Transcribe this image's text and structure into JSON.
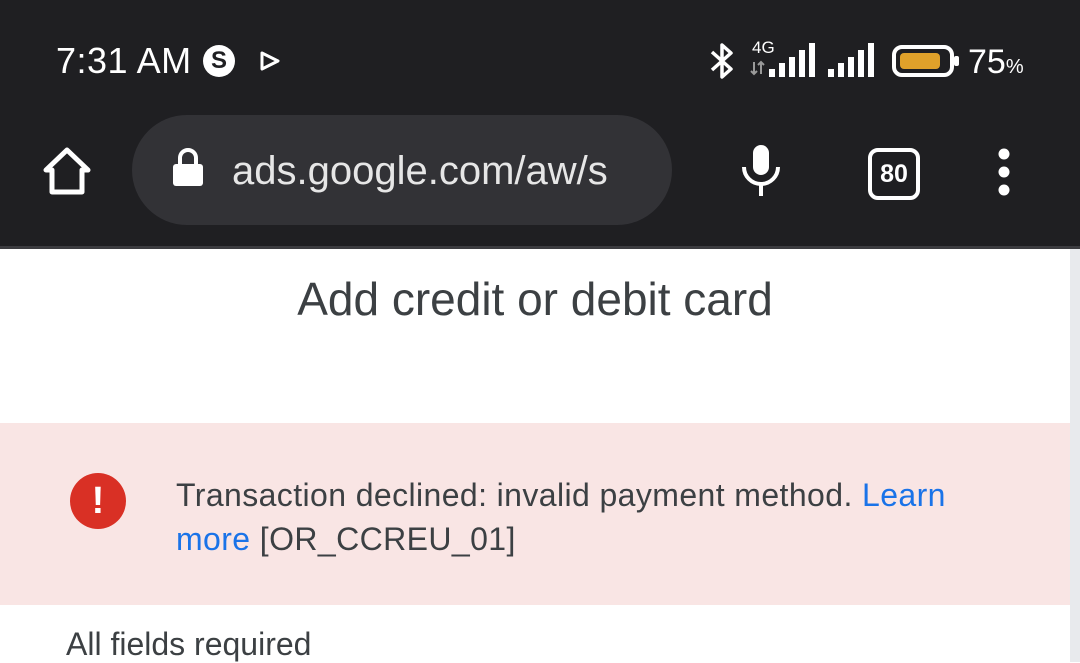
{
  "status_bar": {
    "time": "7:31 AM",
    "app_badge": "S",
    "network_label": "4G",
    "battery_percent": "75",
    "battery_unit": "%",
    "icons": [
      "s-app-icon",
      "play-icon",
      "bluetooth-icon",
      "data-arrows-icon",
      "signal-icon",
      "signal-icon",
      "battery-icon"
    ]
  },
  "browser": {
    "url": "ads.google.com/aw/s",
    "tab_count": "80",
    "icons": [
      "home-icon",
      "lock-icon",
      "mic-icon",
      "tabs-icon",
      "more-vert-icon"
    ]
  },
  "page": {
    "title": "Add credit or debit card",
    "error": {
      "message": "Transaction declined: invalid payment method. ",
      "link_label": "Learn more",
      "code": " [OR_CCREU_01]",
      "icon": "error-icon"
    },
    "required_note": "All fields required"
  },
  "colors": {
    "chrome_bg": "#1f1f22",
    "error_bg": "#f9e5e4",
    "error_red": "#d93025",
    "link_blue": "#1a73e8",
    "battery_fill": "#e0a12a"
  }
}
